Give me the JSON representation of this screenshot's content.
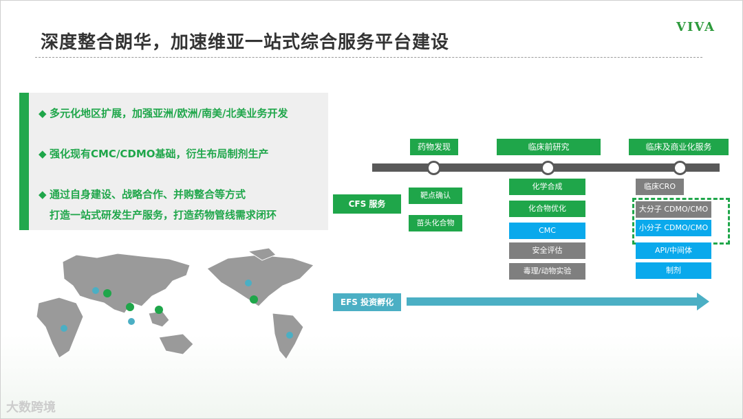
{
  "header": {
    "title": "深度整合朗华，加速维亚一站式综合服务平台建设",
    "logo_text": "VIVA"
  },
  "bullets": {
    "b1": "多元化地区扩展，加强亚洲/欧洲/南美/北美业务开发",
    "b2": "强化现有CMC/CDMO基础，衍生布局制剂生产",
    "b3_line1": "通过自身建设、战略合作、并购整合等方式",
    "b3_line2": "打造一站式研发生产服务，打造药物管线需求闭环",
    "marker": "◆"
  },
  "stages": {
    "s1": "药物发现",
    "s2": "临床前研究",
    "s3": "临床及商业化服务"
  },
  "cfs": {
    "label": "CFS  服务",
    "col1": [
      "靶点确认",
      "苗头化合物"
    ],
    "col2_green": [
      "化学合成",
      "化合物优化"
    ],
    "col2_blue": "CMC",
    "col2_gray": [
      "安全评估",
      "毒理/动物实验"
    ],
    "col3_gray": [
      "临床CRO",
      "大分子 CDMO/CMO"
    ],
    "col3_blue": [
      "小分子 CDMO/CMO",
      "API/中间体",
      "制剂"
    ]
  },
  "efs": {
    "label": "EFS  投资孵化"
  },
  "watermark": "大数跨境",
  "colors": {
    "green": "#1fa64a",
    "blue": "#0aa9ec",
    "gray": "#7f7f7f",
    "teal": "#4bafc4",
    "map_gray": "#9a9a9a"
  }
}
